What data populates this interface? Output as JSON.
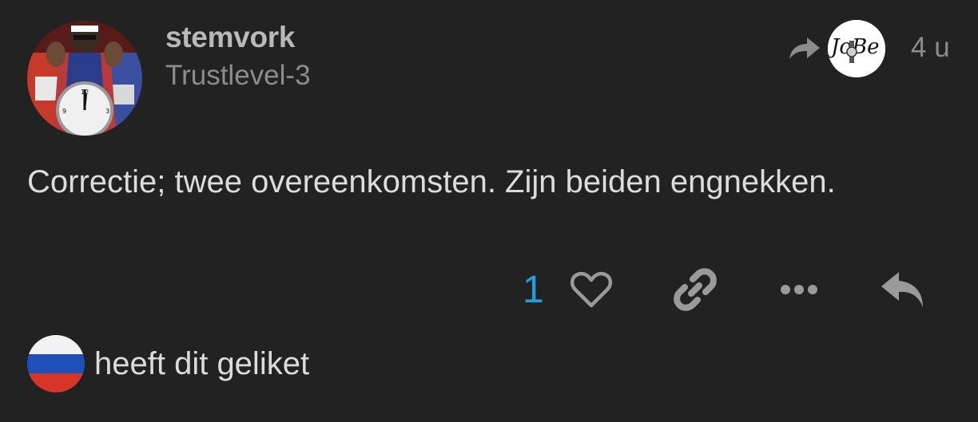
{
  "post": {
    "author": {
      "username": "stemvork",
      "title": "Trustlevel-3",
      "avatar_icon": "avatar-man-with-clock"
    },
    "reply_to": {
      "icon": "share-arrow-icon",
      "avatar_text": "JoBe"
    },
    "date": "4 u",
    "body": "Correctie; twee overeenkomsten. Zijn beiden engnekken.",
    "actions": {
      "like_count": "1",
      "like_icon": "heart-outline-icon",
      "link_icon": "link-icon",
      "more_icon": "ellipsis-icon",
      "reply_icon": "reply-icon"
    },
    "liked_by": {
      "avatar_icon": "russian-flag-avatar",
      "text": "heeft dit geliket"
    },
    "colors": {
      "background": "#222222",
      "accent": "#1ea2dc",
      "muted": "#8c8c8c"
    }
  }
}
